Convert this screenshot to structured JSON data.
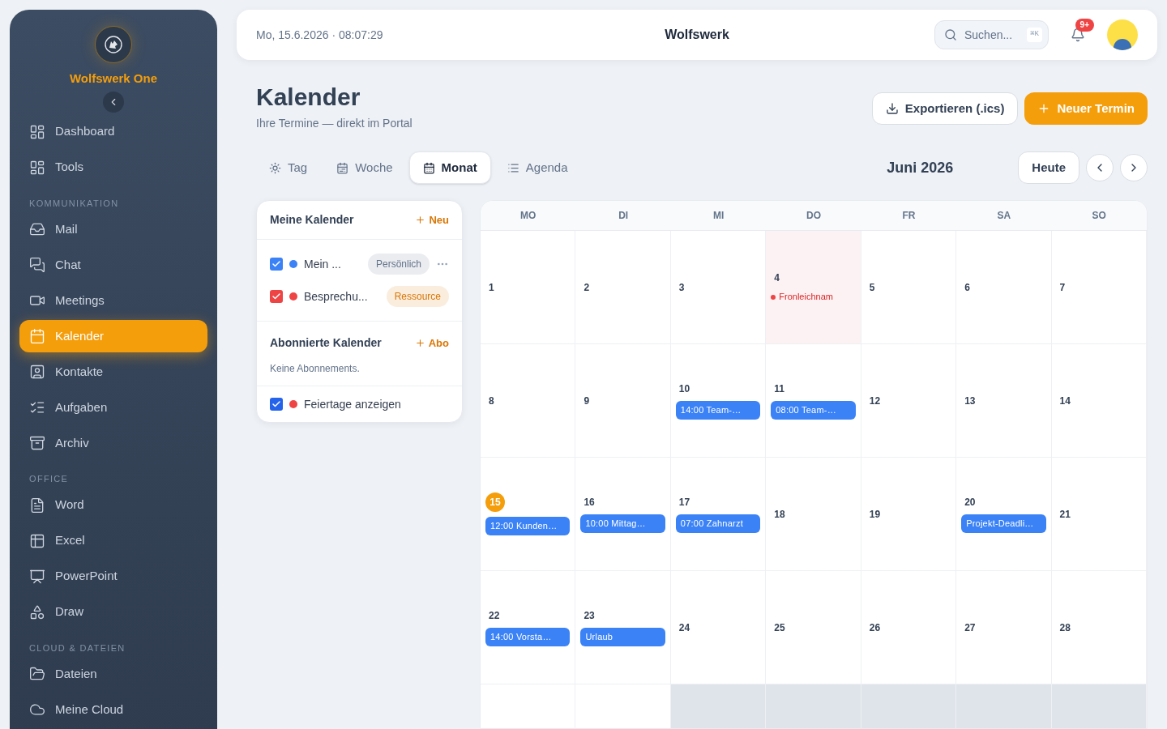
{
  "sidebar": {
    "brand": "Wolfswerk One",
    "items": [
      {
        "kind": "item",
        "label": "Dashboard",
        "selected": false
      },
      {
        "kind": "item",
        "label": "Tools",
        "selected": false
      },
      {
        "kind": "section",
        "label": "KOMMUNIKATION"
      },
      {
        "kind": "item",
        "label": "Mail",
        "selected": false
      },
      {
        "kind": "item",
        "label": "Chat",
        "selected": false
      },
      {
        "kind": "item",
        "label": "Meetings",
        "selected": false
      },
      {
        "kind": "item",
        "label": "Kalender",
        "selected": true
      },
      {
        "kind": "item",
        "label": "Kontakte",
        "selected": false
      },
      {
        "kind": "item",
        "label": "Aufgaben",
        "selected": false
      },
      {
        "kind": "item",
        "label": "Archiv",
        "selected": false
      },
      {
        "kind": "section",
        "label": "OFFICE"
      },
      {
        "kind": "item",
        "label": "Word",
        "selected": false
      },
      {
        "kind": "item",
        "label": "Excel",
        "selected": false
      },
      {
        "kind": "item",
        "label": "PowerPoint",
        "selected": false
      },
      {
        "kind": "item",
        "label": "Draw",
        "selected": false
      },
      {
        "kind": "section",
        "label": "CLOUD & DATEIEN"
      },
      {
        "kind": "item",
        "label": "Dateien",
        "selected": false
      },
      {
        "kind": "item",
        "label": "Meine Cloud",
        "selected": false
      }
    ]
  },
  "topbar": {
    "datetime": "Mo, 15.6.2026 · 08:07:29",
    "title": "Wolfswerk",
    "search": {
      "placeholder": "Suchen...",
      "shortcut": "⌘K"
    },
    "notifications": "9+"
  },
  "page": {
    "title": "Kalender",
    "subtitle": "Ihre Termine — direkt im Portal",
    "actions": [
      {
        "label": "Exportieren (.ics)",
        "kind": "export"
      },
      {
        "label": "Neuer Termin",
        "kind": "new"
      }
    ]
  },
  "views": [
    {
      "label": "Tag",
      "selected": false
    },
    {
      "label": "Woche",
      "selected": false
    },
    {
      "label": "Monat",
      "selected": true
    },
    {
      "label": "Agenda",
      "selected": false
    }
  ],
  "month": "Juni 2026",
  "today_button": "Heute",
  "calendars_panel": {
    "title": "Meine Kalender",
    "add": "Neu",
    "calendars": [
      {
        "name": "Mein ...",
        "color": "#3b82f6",
        "checked": true,
        "tag": {
          "label": "Persönlich",
          "color": "#64748b"
        },
        "menu_button": true
      },
      {
        "name": "Besprechu...",
        "color": "#ef4444",
        "checked": true,
        "tag": {
          "label": "Ressource",
          "color": "#d97706"
        },
        "menu_button": false
      }
    ],
    "subscribed_title": "Abonnierte Kalender",
    "subscribe": "Abo",
    "subscribed_empty": "Keine Abonnements.",
    "holidays": {
      "label": "Feiertage anzeigen",
      "color": "#ef4444",
      "checked": true
    }
  },
  "grid": {
    "weekdays": [
      "MO",
      "DI",
      "MI",
      "DO",
      "FR",
      "SA",
      "SO"
    ],
    "weeks": [
      {
        "days": [
          {
            "n": "1",
            "outside": false,
            "today": false,
            "holiday": false
          },
          {
            "n": "2",
            "outside": false,
            "today": false,
            "holiday": false
          },
          {
            "n": "3",
            "outside": false,
            "today": false,
            "holiday": false
          },
          {
            "n": "4",
            "outside": false,
            "today": false,
            "holiday": true,
            "holiday_name": "Fronleichnam"
          },
          {
            "n": "5",
            "outside": false,
            "today": false,
            "holiday": false
          },
          {
            "n": "6",
            "outside": false,
            "today": false,
            "holiday": false
          },
          {
            "n": "7",
            "outside": false,
            "today": false,
            "holiday": false
          }
        ]
      },
      {
        "days": [
          {
            "n": "8",
            "outside": false,
            "today": false,
            "holiday": false
          },
          {
            "n": "9",
            "outside": false,
            "today": false,
            "holiday": false
          },
          {
            "n": "10",
            "outside": false,
            "today": false,
            "holiday": false,
            "events": [
              "14:00 Team-…"
            ]
          },
          {
            "n": "11",
            "outside": false,
            "today": false,
            "holiday": false,
            "events": [
              "08:00 Team-…"
            ]
          },
          {
            "n": "12",
            "outside": false,
            "today": false,
            "holiday": false
          },
          {
            "n": "13",
            "outside": false,
            "today": false,
            "holiday": false
          },
          {
            "n": "14",
            "outside": false,
            "today": false,
            "holiday": false
          }
        ]
      },
      {
        "days": [
          {
            "n": "15",
            "outside": false,
            "today": true,
            "holiday": false,
            "events": [
              "12:00 Kunden…"
            ]
          },
          {
            "n": "16",
            "outside": false,
            "today": false,
            "holiday": false,
            "events": [
              "10:00 Mittag…"
            ]
          },
          {
            "n": "17",
            "outside": false,
            "today": false,
            "holiday": false,
            "events": [
              "07:00 Zahnarzt"
            ]
          },
          {
            "n": "18",
            "outside": false,
            "today": false,
            "holiday": false
          },
          {
            "n": "19",
            "outside": false,
            "today": false,
            "holiday": false
          },
          {
            "n": "20",
            "outside": false,
            "today": false,
            "holiday": false,
            "events": [
              "Projekt-Deadli…"
            ]
          },
          {
            "n": "21",
            "outside": false,
            "today": false,
            "holiday": false
          }
        ]
      },
      {
        "days": [
          {
            "n": "22",
            "outside": false,
            "today": false,
            "holiday": false,
            "events": [
              "14:00 Vorsta…"
            ]
          },
          {
            "n": "23",
            "outside": false,
            "today": false,
            "holiday": false,
            "events": [
              "Urlaub"
            ]
          },
          {
            "n": "24",
            "outside": false,
            "today": false,
            "holiday": false
          },
          {
            "n": "25",
            "outside": false,
            "today": false,
            "holiday": false
          },
          {
            "n": "26",
            "outside": false,
            "today": false,
            "holiday": false
          },
          {
            "n": "27",
            "outside": false,
            "today": false,
            "holiday": false
          },
          {
            "n": "28",
            "outside": false,
            "today": false,
            "holiday": false
          }
        ]
      },
      {
        "days": [
          {
            "outside": false
          },
          {
            "outside": false
          },
          {
            "outside": true
          },
          {
            "outside": true
          },
          {
            "outside": true
          },
          {
            "outside": true
          },
          {
            "outside": true
          }
        ]
      }
    ]
  }
}
